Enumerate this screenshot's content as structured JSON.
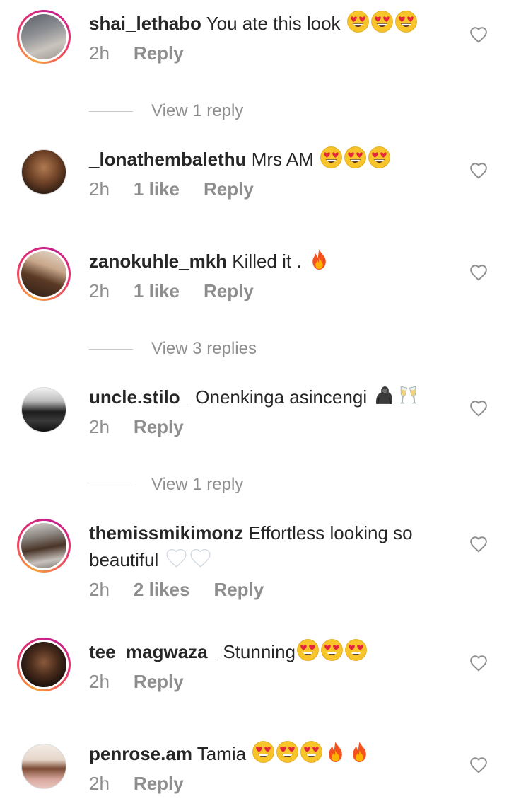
{
  "comments": [
    {
      "username": "shai_lethabo",
      "text": "You ate this look",
      "emojis": [
        "heart-eyes",
        "heart-eyes",
        "heart-eyes"
      ],
      "time": "2h",
      "likes": "",
      "reply": "Reply",
      "story_ring": true,
      "view_replies": "View 1 reply"
    },
    {
      "username": "_lonathembalethu",
      "text": "Mrs AM",
      "emojis": [
        "heart-eyes",
        "heart-eyes",
        "heart-eyes"
      ],
      "time": "2h",
      "likes": "1 like",
      "reply": "Reply",
      "story_ring": false,
      "view_replies": ""
    },
    {
      "username": "zanokuhle_mkh",
      "text": "Killed it .",
      "emojis": [
        "fire"
      ],
      "time": "2h",
      "likes": "1 like",
      "reply": "Reply",
      "story_ring": true,
      "view_replies": "View 3 replies"
    },
    {
      "username": "uncle.stilo_",
      "text": "Onenkinga asincengi",
      "emojis": [
        "gorilla",
        "champagne-glasses"
      ],
      "time": "2h",
      "likes": "",
      "reply": "Reply",
      "story_ring": false,
      "view_replies": "View 1 reply"
    },
    {
      "username": "themissmikimonz",
      "text": "Effortless looking so beautiful",
      "emojis": [
        "white-heart",
        "white-heart"
      ],
      "time": "2h",
      "likes": "2 likes",
      "reply": "Reply",
      "story_ring": true,
      "view_replies": ""
    },
    {
      "username": "tee_magwaza_",
      "text": "Stunning",
      "emojis": [
        "heart-eyes",
        "heart-eyes",
        "heart-eyes"
      ],
      "time": "2h",
      "likes": "",
      "reply": "Reply",
      "story_ring": true,
      "view_replies": ""
    },
    {
      "username": "penrose.am",
      "text": "Tamia",
      "emojis": [
        "heart-eyes",
        "heart-eyes",
        "heart-eyes",
        "fire",
        "fire"
      ],
      "time": "2h",
      "likes": "",
      "reply": "Reply",
      "story_ring": false,
      "view_replies": ""
    }
  ],
  "colors": {
    "text": "#262626",
    "secondary": "#8e8e8e",
    "divider": "#c7c7c7",
    "story_ring_start": "#f9a33b",
    "story_ring_end": "#c31f8d"
  }
}
